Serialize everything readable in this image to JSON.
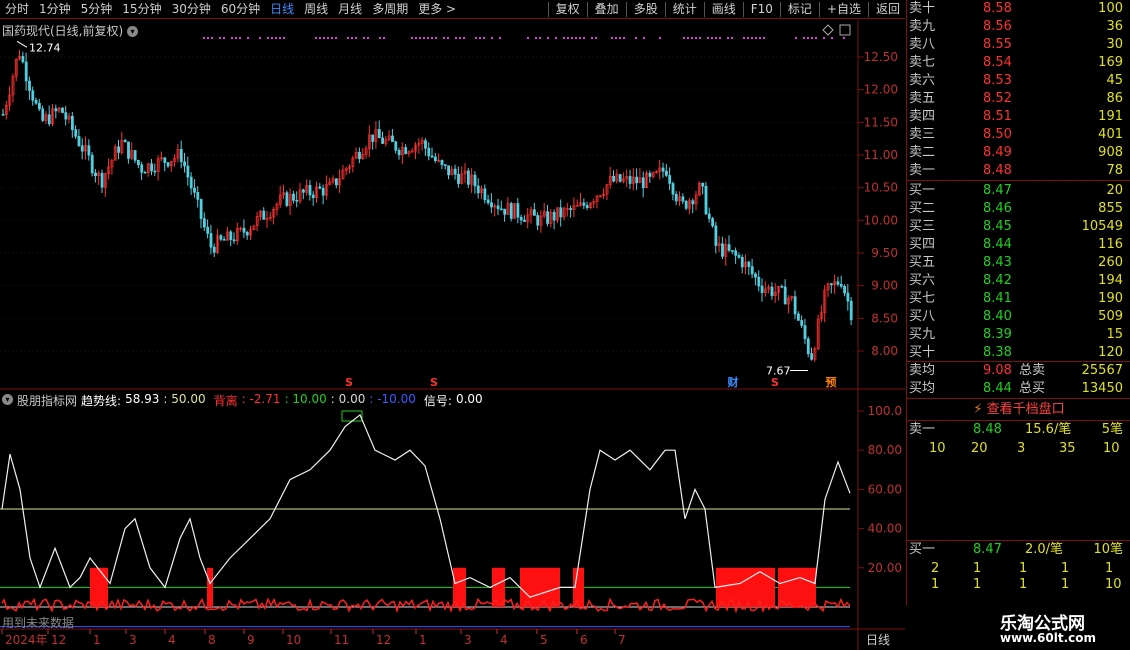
{
  "toolbar": {
    "periods": [
      "分时",
      "1分钟",
      "5分钟",
      "15分钟",
      "30分钟",
      "60分钟",
      "日线",
      "周线",
      "月线",
      "多周期",
      "更多 >"
    ],
    "active_period": "日线",
    "actions": [
      "复权",
      "叠加",
      "多股",
      "统计",
      "画线",
      "F10",
      "标记",
      "+自选",
      "返回"
    ]
  },
  "stock_title": "国药现代(日线,前复权)",
  "price_axis": [
    "12.50",
    "12.00",
    "11.50",
    "11.00",
    "10.50",
    "10.00",
    "9.50",
    "9.00",
    "8.50",
    "8.00"
  ],
  "high_marker": "12.74",
  "low_marker": "7.67",
  "event_markers": [
    {
      "label": "S",
      "color": "#ff3030"
    },
    {
      "label": "S",
      "color": "#ff3030"
    },
    {
      "label": "财",
      "color": "#3a8cff"
    },
    {
      "label": "S",
      "color": "#ff3030"
    },
    {
      "label": "预",
      "color": "#ff8000"
    }
  ],
  "indicator": {
    "name": "股朋指标网",
    "trend_label": "趋势线:",
    "trend_value": "58.93",
    "level1": ": 50.00",
    "diverge_label": "背离",
    "diverge_value": ": -2.71",
    "level2": ": 10.00",
    "level3": ": 0.00",
    "level4": ": -10.00",
    "signal_label": "信号:",
    "signal_value": "0.00",
    "footer_note": "用到未来数据",
    "axis": [
      "100.0",
      "80.00",
      "60.00",
      "40.00",
      "20.00"
    ]
  },
  "date_axis": [
    "2024年",
    "12",
    "1",
    "3",
    "4",
    "8",
    "9",
    "10",
    "11",
    "12",
    "1",
    "3",
    "4",
    "5",
    "6",
    "7"
  ],
  "period_label": "日线",
  "orderbook": {
    "asks": [
      {
        "label": "卖十",
        "price": "8.58",
        "vol": "100"
      },
      {
        "label": "卖九",
        "price": "8.56",
        "vol": "36"
      },
      {
        "label": "卖八",
        "price": "8.55",
        "vol": "30"
      },
      {
        "label": "卖七",
        "price": "8.54",
        "vol": "169"
      },
      {
        "label": "卖六",
        "price": "8.53",
        "vol": "45"
      },
      {
        "label": "卖五",
        "price": "8.52",
        "vol": "86"
      },
      {
        "label": "卖四",
        "price": "8.51",
        "vol": "191"
      },
      {
        "label": "卖三",
        "price": "8.50",
        "vol": "401"
      },
      {
        "label": "卖二",
        "price": "8.49",
        "vol": "908"
      },
      {
        "label": "卖一",
        "price": "8.48",
        "vol": "78"
      }
    ],
    "bids": [
      {
        "label": "买一",
        "price": "8.47",
        "vol": "20"
      },
      {
        "label": "买二",
        "price": "8.46",
        "vol": "855"
      },
      {
        "label": "买三",
        "price": "8.45",
        "vol": "10549"
      },
      {
        "label": "买四",
        "price": "8.44",
        "vol": "116"
      },
      {
        "label": "买五",
        "price": "8.43",
        "vol": "260"
      },
      {
        "label": "买六",
        "price": "8.42",
        "vol": "194"
      },
      {
        "label": "买七",
        "price": "8.41",
        "vol": "190"
      },
      {
        "label": "买八",
        "price": "8.40",
        "vol": "509"
      },
      {
        "label": "买九",
        "price": "8.39",
        "vol": "15"
      },
      {
        "label": "买十",
        "price": "8.38",
        "vol": "120"
      }
    ],
    "ask_avg_label": "卖均",
    "ask_avg": "9.08",
    "total_sell_label": "总卖",
    "total_sell": "25567",
    "bid_avg_label": "买均",
    "bid_avg": "8.44",
    "total_buy_label": "总买",
    "total_buy": "13450",
    "view_depth": "查看千档盘口",
    "sell1_label": "卖一",
    "sell1_price": "8.48",
    "sell1_avg": "15.6/笔",
    "sell1_count": "5笔",
    "sell1_queue": [
      "10",
      "20",
      "3",
      "35",
      "10"
    ],
    "buy1_label": "买一",
    "buy1_price": "8.47",
    "buy1_avg": "2.0/笔",
    "buy1_count": "10笔",
    "buy1_queue_row1": [
      "2",
      "1",
      "1",
      "1",
      "1"
    ],
    "buy1_queue_row2": [
      "1",
      "1",
      "1",
      "1",
      "10"
    ]
  },
  "watermark": {
    "title": "乐淘公式网",
    "url": "www.60lt.com"
  }
}
